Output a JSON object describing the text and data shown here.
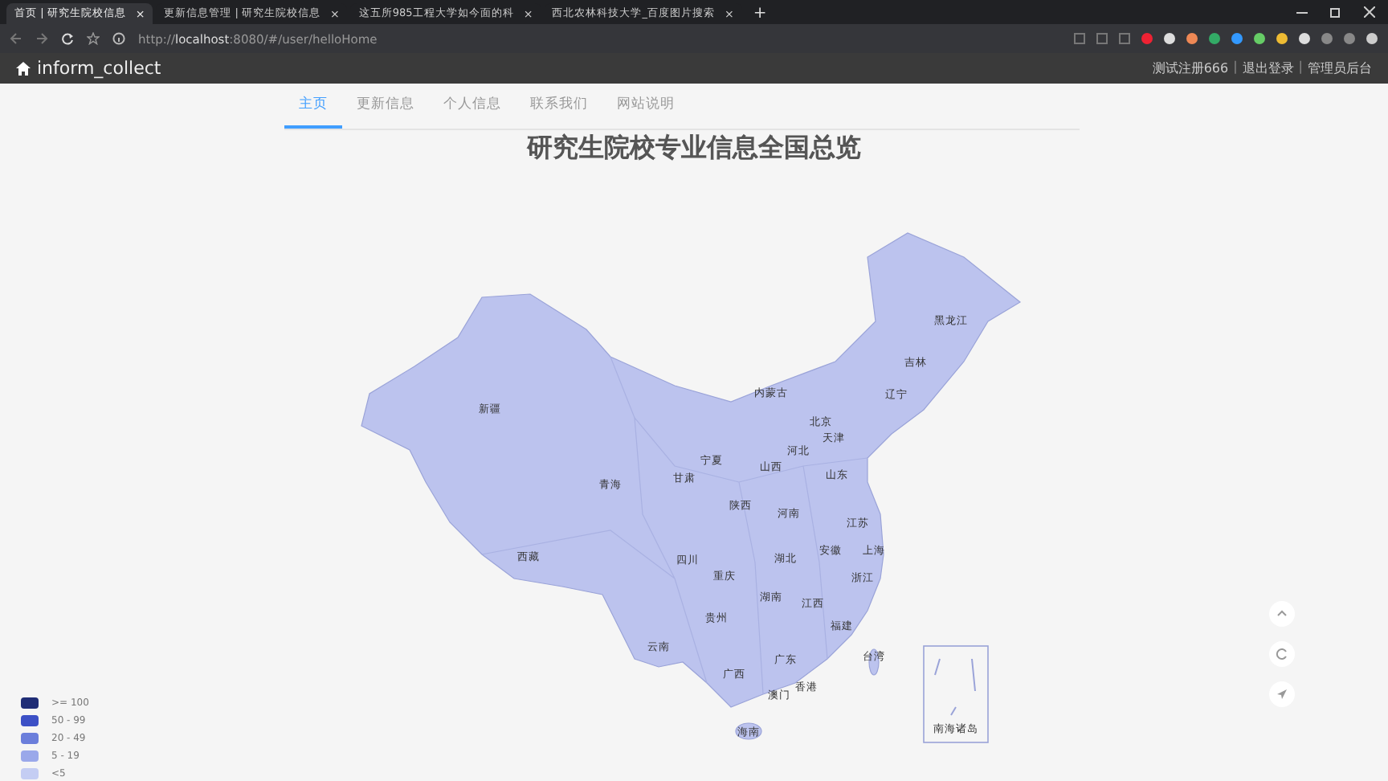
{
  "browser": {
    "tabs": [
      {
        "title": "首页 | 研究生院校信息",
        "selected": true
      },
      {
        "title": "更新信息管理 | 研究生院校信息",
        "selected": false
      },
      {
        "title": "这五所985工程大学如今面的科",
        "selected": false
      },
      {
        "title": "西北农林科技大学_百度图片搜索",
        "selected": false
      }
    ],
    "tab_close": "×",
    "new_tab": "+",
    "url_prefix": "http://",
    "url_host": "localhost",
    "url_rest": ":8080/#/user/helloHome"
  },
  "header": {
    "brand": "inform_collect",
    "user_links": [
      "测试注册666",
      "退出登录",
      "管理员后台"
    ],
    "separator": "|"
  },
  "nav": [
    {
      "label": "主页",
      "selected": true
    },
    {
      "label": "更新信息",
      "selected": false
    },
    {
      "label": "个人信息",
      "selected": false
    },
    {
      "label": "联系我们",
      "selected": false
    },
    {
      "label": "网站说明",
      "selected": false
    }
  ],
  "title": "研究生院校专业信息全国总览",
  "map": {
    "provinces": [
      "黑龙江",
      "吉林",
      "辽宁",
      "内蒙古",
      "北京",
      "天津",
      "河北",
      "山西",
      "宁夏",
      "山东",
      "甘肃",
      "青海",
      "新疆",
      "西藏",
      "陕西",
      "河南",
      "江苏",
      "安徽",
      "上海",
      "四川",
      "湖北",
      "重庆",
      "浙江",
      "湖南",
      "江西",
      "贵州",
      "福建",
      "云南",
      "广西",
      "广东",
      "台湾",
      "澳门",
      "香港",
      "海南"
    ],
    "inset_label": "南海诸岛"
  },
  "legend": [
    {
      "label": ">= 100",
      "color": "#1f2d76"
    },
    {
      "label": "50 - 99",
      "color": "#3c50c6"
    },
    {
      "label": "20 - 49",
      "color": "#6b7edb"
    },
    {
      "label": "5 - 19",
      "color": "#9aa8ea"
    },
    {
      "label": "<5",
      "color": "#c4cdf3"
    }
  ]
}
